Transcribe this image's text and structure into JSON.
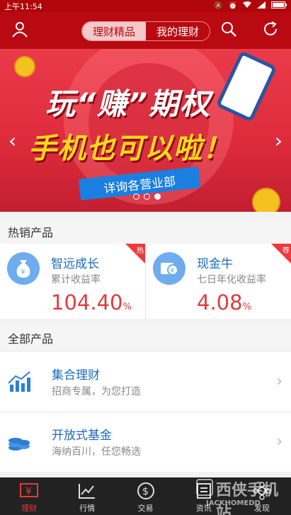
{
  "status_bar": {
    "time": "上午11:54"
  },
  "header": {
    "tabs": [
      {
        "label": "理财精品"
      },
      {
        "label": "我的理财"
      }
    ]
  },
  "banner": {
    "title": "玩“赚”期权",
    "subtitle": "手机也可以啦！",
    "button": "详询各营业部"
  },
  "hot_section": {
    "title": "热销产品"
  },
  "hot_products": [
    {
      "name": "智远成长",
      "desc": "累计收益率",
      "rate": "104.40",
      "unit": "%",
      "badge": "热",
      "icon": "money-bag-icon"
    },
    {
      "name": "现金牛",
      "desc": "七日年化收益率",
      "rate": "4.08",
      "unit": "%",
      "badge": "荐",
      "icon": "cash-icon"
    }
  ],
  "all_section": {
    "title": "全部产品"
  },
  "all_products": [
    {
      "title": "集合理财",
      "desc": "招商专属，为您打造",
      "icon": "bar-chart-icon"
    },
    {
      "title": "开放式基金",
      "desc": "海纳百川，任您畅选",
      "icon": "coins-icon"
    }
  ],
  "tabbar": [
    {
      "label": "理财",
      "icon": "yen-icon"
    },
    {
      "label": "行情",
      "icon": "chart-line-icon"
    },
    {
      "label": "交易",
      "icon": "dollar-icon"
    },
    {
      "label": "资讯",
      "icon": "news-icon"
    },
    {
      "label": "发现",
      "icon": "discover-icon"
    }
  ],
  "watermark": {
    "main": "西侠手机站",
    "sub": "JACKHOMEDD"
  },
  "colors": {
    "brand_red": "#b80a10",
    "accent_blue": "#1a69c4",
    "rate_red": "#e23b3b"
  }
}
